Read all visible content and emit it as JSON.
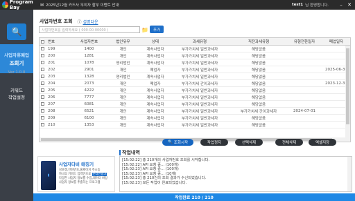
{
  "app": {
    "name": "Program Bay"
  },
  "notice": {
    "text": "2025년12월 카드사 무이자 할부 이벤트 안내"
  },
  "user": {
    "name": "test1",
    "greeting": "님 환영합니다."
  },
  "sidebar": {
    "menu1_line1": "사업자휴폐업",
    "menu1_line2": "조회기",
    "version": "Ver 1.0.0",
    "menu2_line1": "키워드",
    "menu2_line2": "작업설정"
  },
  "section": {
    "title": "사업자번호 조회",
    "help_icon": "question-icon",
    "help_label": "설명다운"
  },
  "search": {
    "placeholder": "사업자번호를 입력하세요 ( 000-00-00000 )"
  },
  "add_label": "추가",
  "table": {
    "headers": [
      "번호",
      "사업자번호",
      "법인유무",
      "상태",
      "과세유형",
      "직전과세유형",
      "유형전환일자",
      "폐업일자"
    ],
    "rows": [
      [
        "199",
        "1400",
        "개인",
        "계속사업자",
        "부가가치세 일반과세자",
        "해당없음",
        "",
        ""
      ],
      [
        "200",
        "1281",
        "개인",
        "계속사업자",
        "부가가치세 일반과세자",
        "해당없음",
        "",
        ""
      ],
      [
        "201",
        "1078",
        "영리법인",
        "계속사업자",
        "부가가치세 일반과세자",
        "해당없음",
        "",
        ""
      ],
      [
        "202",
        "2901",
        "개인",
        "폐업자",
        "부가가치세 일반과세자",
        "해당없음",
        "",
        "2025-06-30"
      ],
      [
        "203",
        "1328",
        "영리법인",
        "계속사업자",
        "부가가치세 일반과세자",
        "해당없음",
        "",
        ""
      ],
      [
        "204",
        "2073",
        "개인",
        "폐업자",
        "부가가치세 간이과세자",
        "해당없음",
        "",
        "2023-12-31"
      ],
      [
        "205",
        "4222",
        "개인",
        "계속사업자",
        "부가가치세 일반과세자",
        "해당없음",
        "",
        ""
      ],
      [
        "206",
        "7777",
        "개인",
        "계속사업자",
        "부가가치세 일반과세자",
        "해당없음",
        "",
        ""
      ],
      [
        "207",
        "6081",
        "개인",
        "계속사업자",
        "부가가치세 일반과세자",
        "해당없음",
        "",
        ""
      ],
      [
        "208",
        "6521",
        "개인",
        "계속사업자",
        "부가가치세 일반과세자",
        "부가가치세 간이과세자",
        "2024-07-01",
        ""
      ],
      [
        "209",
        "6100",
        "개인",
        "계속사업자",
        "부가가치세 일반과세자",
        "해당없음",
        "",
        ""
      ],
      [
        "210",
        "1353",
        "개인",
        "계속사업자",
        "부가가치세 일반과세자",
        "해당없음",
        "",
        ""
      ]
    ]
  },
  "buttons": {
    "start": "조회시작",
    "stop": "작업정지",
    "delete_selected": "선택삭제",
    "delete_all": "전체삭제",
    "excel": "엑셀저장"
  },
  "ad": {
    "title": "사업자다비 매칭기",
    "line1": "성포켓,전화번호,홈페이지 주소등",
    "line2a": "하나의 키워드 입력만으로",
    "line2b": "온라인광고",
    "line3": "다양한 사업자 정보를 수집,데이터 바탕",
    "line4": "사업자 정보를 추출하는 프로그램"
  },
  "log": {
    "title": "작업내역",
    "lines": [
      "[15:02:22] 총 210개의 사업자번호 조회를 시작합니다.",
      "[15:02:22] API 요청 중... (100개)",
      "[15:02:23] API 요청 중... (100개)",
      "[15:02:23] API 요청 중... (10개)",
      "[15:02:23] 총 210건의 조회 결과가 수신되었습니다.",
      "[15:02:23] 모든 작업이 완료되었습니다."
    ]
  },
  "progress": {
    "label": "작업완료 210 / 210",
    "done": 210,
    "total": 210
  },
  "colors": {
    "accent": "#1e6fc9",
    "progress": "#1e88e5",
    "sidebar": "#3a3f47",
    "titlebar": "#2b2b2b"
  }
}
